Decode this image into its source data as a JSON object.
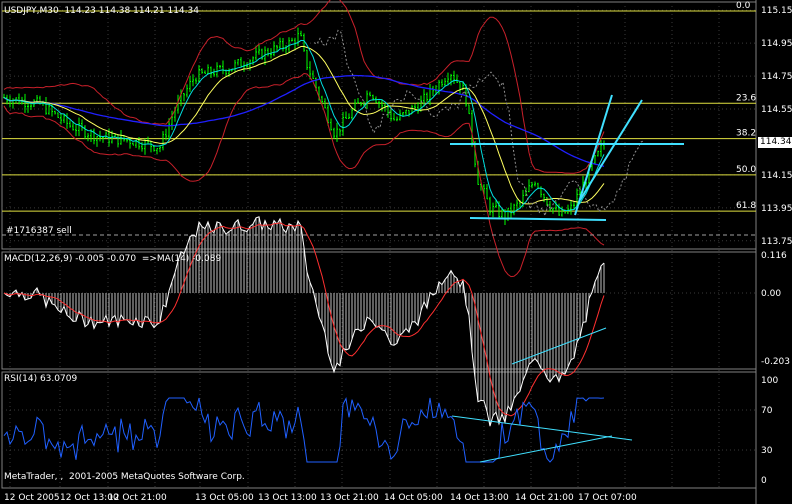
{
  "colors": {
    "background": "#000000",
    "grid": "#3a3a3a",
    "bars": "#00ff00",
    "bollinger": "#c8202a",
    "ma_slow": "#2020ff",
    "ma_fast": "#00e0e0",
    "ma_mid": "#ffff60",
    "fibo": "#e0e040",
    "trend": "#40e0ff",
    "macd_signal": "#ff3030",
    "rsi": "#2060ff",
    "text": "#ffffff"
  },
  "main": {
    "title": "USDJPY,M30  114.23 114.38 114.21 114.34",
    "price_labels": [
      "115.15",
      "114.95",
      "114.75",
      "114.55",
      "114.34",
      "114.15",
      "113.95",
      "113.75"
    ],
    "current_price": "114.34",
    "fibo_labels": [
      "0.0",
      "23.6",
      "38.2",
      "50.0",
      "61.8"
    ],
    "order_label": "#1716387 sell",
    "price_range": [
      113.7,
      115.2
    ],
    "fibo_levels": [
      {
        "label": "0.0",
        "price": 115.145
      },
      {
        "label": "23.6",
        "price": 114.585
      },
      {
        "label": "38.2",
        "price": 114.37
      },
      {
        "label": "50.0",
        "price": 114.15
      },
      {
        "label": "61.8",
        "price": 113.93
      }
    ]
  },
  "macd": {
    "title": "MACD(12,26,9) -0.005 -0.070  =>MA(14) -0.089",
    "labels": [
      "0.116",
      "0.00",
      "-0.203"
    ]
  },
  "rsi": {
    "title": "RSI(14) 63.0709",
    "labels": [
      "100",
      "70",
      "30",
      "0"
    ]
  },
  "time_labels": [
    "12 Oct 2005",
    "12 Oct 13:00",
    "12 Oct 21:00",
    "13 Oct 05:00",
    "13 Oct 13:00",
    "13 Oct 21:00",
    "14 Oct 05:00",
    "14 Oct 13:00",
    "14 Oct 21:00",
    "17 Oct 07:00"
  ],
  "copyright": "MetaTrader, ,  2001-2005 MetaQuotes Software Corp."
}
